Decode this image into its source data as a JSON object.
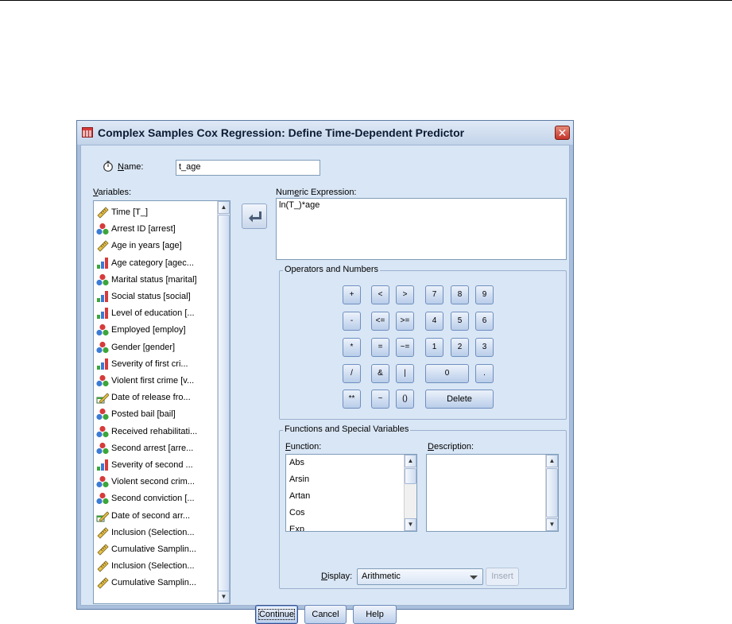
{
  "dialog": {
    "title": "Complex Samples Cox Regression: Define Time-Dependent Predictor",
    "close_glyph": "✕"
  },
  "name_field": {
    "label": "Name:",
    "value": "t_age"
  },
  "variables": {
    "label": "Variables:",
    "items": [
      {
        "label": "Time [T_]",
        "icon": "scale-ruler-icon"
      },
      {
        "label": "Arrest ID [arrest]",
        "icon": "nominal-icon"
      },
      {
        "label": "Age in years [age]",
        "icon": "scale-ruler-icon"
      },
      {
        "label": "Age category [agec...",
        "icon": "ordinal-icon"
      },
      {
        "label": "Marital status [marital]",
        "icon": "nominal-icon"
      },
      {
        "label": "Social status [social]",
        "icon": "ordinal-icon"
      },
      {
        "label": "Level of education [...",
        "icon": "ordinal-icon"
      },
      {
        "label": "Employed [employ]",
        "icon": "nominal-icon"
      },
      {
        "label": "Gender [gender]",
        "icon": "nominal-icon"
      },
      {
        "label": "Severity of first cri...",
        "icon": "ordinal-icon"
      },
      {
        "label": "Violent first crime [v...",
        "icon": "nominal-icon"
      },
      {
        "label": "Date of release fro...",
        "icon": "date-ruler-icon"
      },
      {
        "label": "Posted bail [bail]",
        "icon": "nominal-icon"
      },
      {
        "label": "Received rehabilitati...",
        "icon": "nominal-icon"
      },
      {
        "label": "Second arrest [arre...",
        "icon": "nominal-icon"
      },
      {
        "label": "Severity of second ...",
        "icon": "ordinal-icon"
      },
      {
        "label": "Violent second crim...",
        "icon": "nominal-icon"
      },
      {
        "label": "Second conviction [...",
        "icon": "nominal-icon"
      },
      {
        "label": "Date of second arr...",
        "icon": "date-ruler-icon"
      },
      {
        "label": "Inclusion (Selection...",
        "icon": "scale-ruler-icon"
      },
      {
        "label": "Cumulative Samplin...",
        "icon": "scale-ruler-icon"
      },
      {
        "label": "Inclusion (Selection...",
        "icon": "scale-ruler-icon"
      },
      {
        "label": "Cumulative Samplin...",
        "icon": "scale-ruler-icon"
      }
    ]
  },
  "numeric_expression": {
    "label": "Numeric Expression:",
    "value": "ln(T_)*age"
  },
  "operators": {
    "title": "Operators and Numbers",
    "keys": {
      "plus": "+",
      "lt": "<",
      "gt": ">",
      "n7": "7",
      "n8": "8",
      "n9": "9",
      "minus": "-",
      "le": "<=",
      "ge": ">=",
      "n4": "4",
      "n5": "5",
      "n6": "6",
      "mult": "*",
      "eq": "=",
      "ne": "~=",
      "n1": "1",
      "n2": "2",
      "n3": "3",
      "div": "/",
      "and": "&",
      "or": "|",
      "n0": "0",
      "dot": ".",
      "pow": "**",
      "not": "~",
      "paren": "()",
      "delete": "Delete"
    }
  },
  "functions": {
    "title": "Functions and Special Variables",
    "function_label": "Function:",
    "description_label": "Description:",
    "items": [
      "Abs",
      "Arsin",
      "Artan",
      "Cos",
      "Exp"
    ],
    "display_label": "Display:",
    "display_value": "Arithmetic",
    "insert_label": "Insert"
  },
  "buttons": {
    "continue": "Continue",
    "cancel": "Cancel",
    "help": "Help"
  },
  "colors": {
    "title_gradient_top": "#dfe9f6",
    "client_bg": "#d9e6f5",
    "frame": "#a9bfdc",
    "close_red": "#c4352a"
  }
}
